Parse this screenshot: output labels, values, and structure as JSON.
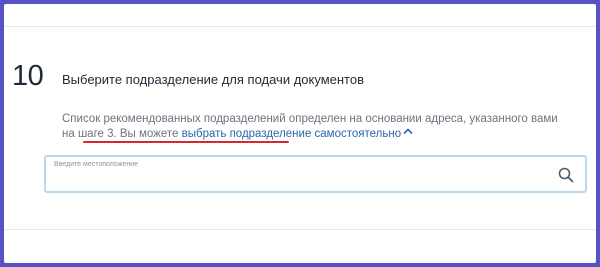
{
  "step": {
    "number": "10",
    "title": "Выберите подразделение для подачи документов"
  },
  "description": {
    "text": "Список рекомендованных подразделений определен на основании адреса, указанного вами на шаге 3. Вы можете ",
    "link_label": "выбрать подразделение самостоятельно"
  },
  "search": {
    "label": "Введите местоположение",
    "value": ""
  },
  "colors": {
    "link": "#2a67ad",
    "underline": "#d9272e",
    "field_border": "#b9d9f1",
    "frame": "#5753c4"
  },
  "icons": {
    "link_chevron": "chevron-up-icon",
    "search": "search-icon"
  }
}
